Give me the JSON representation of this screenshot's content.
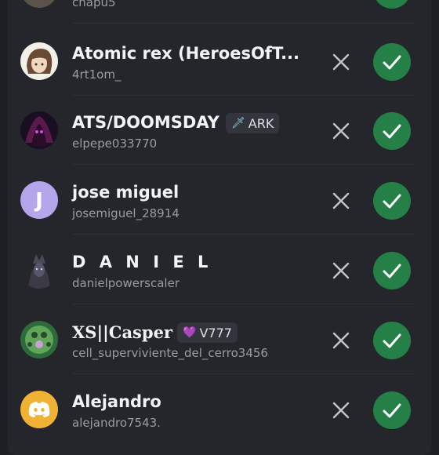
{
  "requests": [
    {
      "name": "",
      "username": "chapu5",
      "tag": null
    },
    {
      "name": "Atomic rex (HeroesOfT...",
      "username": "4rt1om_",
      "tag": null
    },
    {
      "name": "ATS/DOOMSDAY",
      "username": "elpepe033770",
      "tag": {
        "icon": "sword-icon",
        "label": "ARK"
      }
    },
    {
      "name": "jose miguel",
      "username": "josemiguel_28914",
      "tag": null,
      "avatar_letter": "J"
    },
    {
      "name": "D A N I E L",
      "username": "danielpowerscaler",
      "tag": null
    },
    {
      "name": "XS||Casper",
      "username": "cell_superviviente_del_cerro3456",
      "tag": {
        "icon": "heart-gem-icon",
        "label": "V777"
      }
    },
    {
      "name": "Alejandro",
      "username": "alejandro7543.",
      "tag": null
    }
  ],
  "icons": {
    "decline": "close-icon",
    "accept": "checkmark-icon"
  },
  "colors": {
    "background": "#1e1f24",
    "panel": "#25262c",
    "accept": "#248046",
    "muted_text": "#9a9ca5",
    "jose_avatar": "#b5a6ec",
    "alejandro_avatar": "#f0b232"
  }
}
